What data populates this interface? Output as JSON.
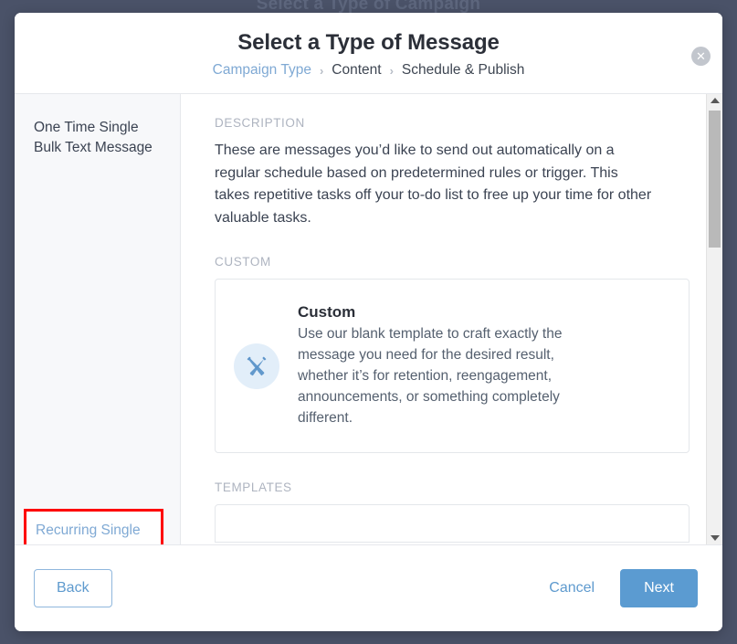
{
  "background": {
    "behind_title": "Select a Type of Campaign",
    "color": "#4a5268"
  },
  "modal": {
    "title": "Select a Type of Message",
    "close_label": "✕",
    "breadcrumb": [
      {
        "label": "Campaign Type",
        "state": "link"
      },
      {
        "label": "Content",
        "state": "current"
      },
      {
        "label": "Schedule & Publish",
        "state": "current"
      }
    ],
    "separator": "›"
  },
  "sidebar": {
    "items": [
      {
        "label": "One Time Single Bulk Text Message",
        "selected": false
      },
      {
        "label": "Recurring Single Bulk Text Message",
        "selected": true
      }
    ]
  },
  "content": {
    "description_label": "DESCRIPTION",
    "description_text": "These are messages you’d like to send out automatically on a regular schedule based on predetermined rules or trigger. This takes repetitive tasks off your to-do list to free up your time for other valuable tasks.",
    "custom_label": "CUSTOM",
    "custom_card": {
      "icon": "pencil-ruler-icon",
      "title": "Custom",
      "description": "Use our blank template to craft exactly the message you need for the desired result, whether it’s for retention, reengagement, announcements, or something completely different."
    },
    "templates_label": "TEMPLATES"
  },
  "scrollbar": {
    "up_arrow": "▲",
    "down_arrow": "▼"
  },
  "footer": {
    "back_label": "Back",
    "cancel_label": "Cancel",
    "next_label": "Next"
  },
  "colors": {
    "accent_blue": "#5b9bd1",
    "link_blue": "#7fa9d4",
    "annotation_red": "#fe0000",
    "sidebar_bg": "#f7f8fa"
  }
}
